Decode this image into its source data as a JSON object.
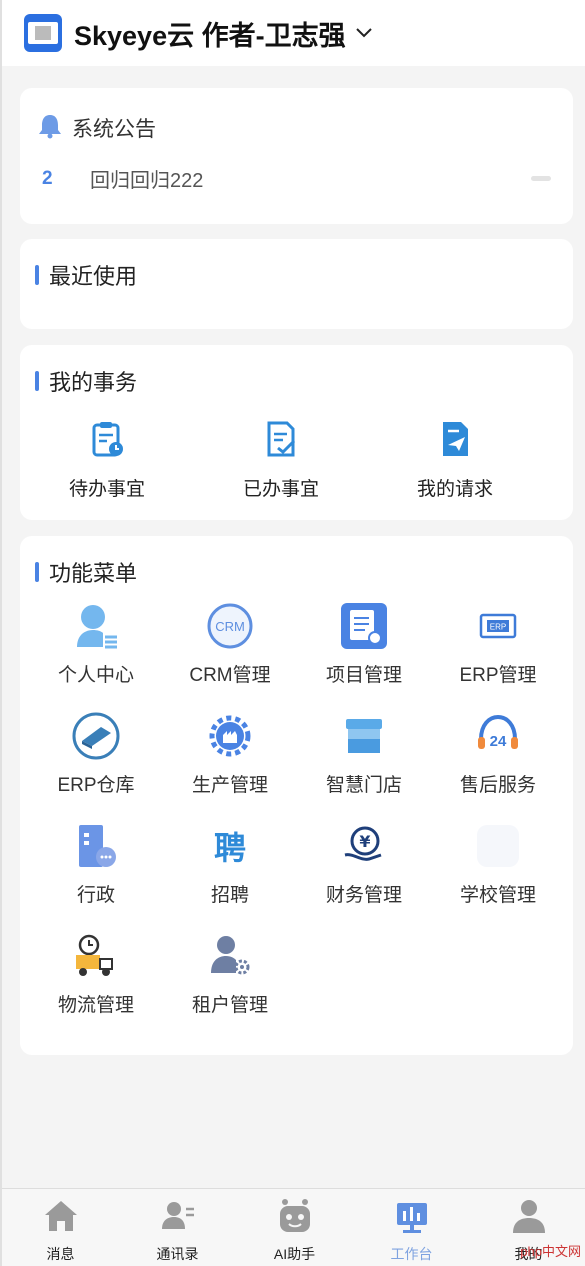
{
  "header": {
    "title": "Skyeye云 作者-卫志强"
  },
  "notice": {
    "title": "系统公告",
    "items": [
      {
        "index": "2",
        "text": "回归回归222"
      }
    ]
  },
  "recent": {
    "title": "最近使用"
  },
  "affairs": {
    "title": "我的事务",
    "items": [
      {
        "label": "待办事宜",
        "icon": "clipboard-clock-icon"
      },
      {
        "label": "已办事宜",
        "icon": "document-check-icon"
      },
      {
        "label": "我的请求",
        "icon": "paper-plane-doc-icon"
      }
    ]
  },
  "menu": {
    "title": "功能菜单",
    "items": [
      {
        "label": "个人中心",
        "icon": "user-icon"
      },
      {
        "label": "CRM管理",
        "icon": "crm-icon"
      },
      {
        "label": "项目管理",
        "icon": "project-icon"
      },
      {
        "label": "ERP管理",
        "icon": "erp-card-icon"
      },
      {
        "label": "ERP仓库",
        "icon": "warehouse-icon"
      },
      {
        "label": "生产管理",
        "icon": "factory-gear-icon"
      },
      {
        "label": "智慧门店",
        "icon": "store-icon"
      },
      {
        "label": "售后服务",
        "icon": "headset-24-icon"
      },
      {
        "label": "行政",
        "icon": "admin-building-icon"
      },
      {
        "label": "招聘",
        "icon": "recruit-icon"
      },
      {
        "label": "财务管理",
        "icon": "finance-yuan-icon"
      },
      {
        "label": "学校管理",
        "icon": "school-icon"
      },
      {
        "label": "物流管理",
        "icon": "logistics-truck-icon"
      },
      {
        "label": "租户管理",
        "icon": "tenant-gear-icon"
      }
    ]
  },
  "tabbar": {
    "items": [
      {
        "label": "消息",
        "icon": "home-icon",
        "active": false
      },
      {
        "label": "通讯录",
        "icon": "contacts-icon",
        "active": false
      },
      {
        "label": "AI助手",
        "icon": "robot-icon",
        "active": false
      },
      {
        "label": "工作台",
        "icon": "workbench-icon",
        "active": true
      },
      {
        "label": "我的",
        "icon": "profile-icon",
        "active": false
      }
    ]
  },
  "watermark": "php中文网",
  "colors": {
    "accent": "#4a83e3",
    "active_tab": "#7fa3e0",
    "background": "#f4f4f4"
  }
}
